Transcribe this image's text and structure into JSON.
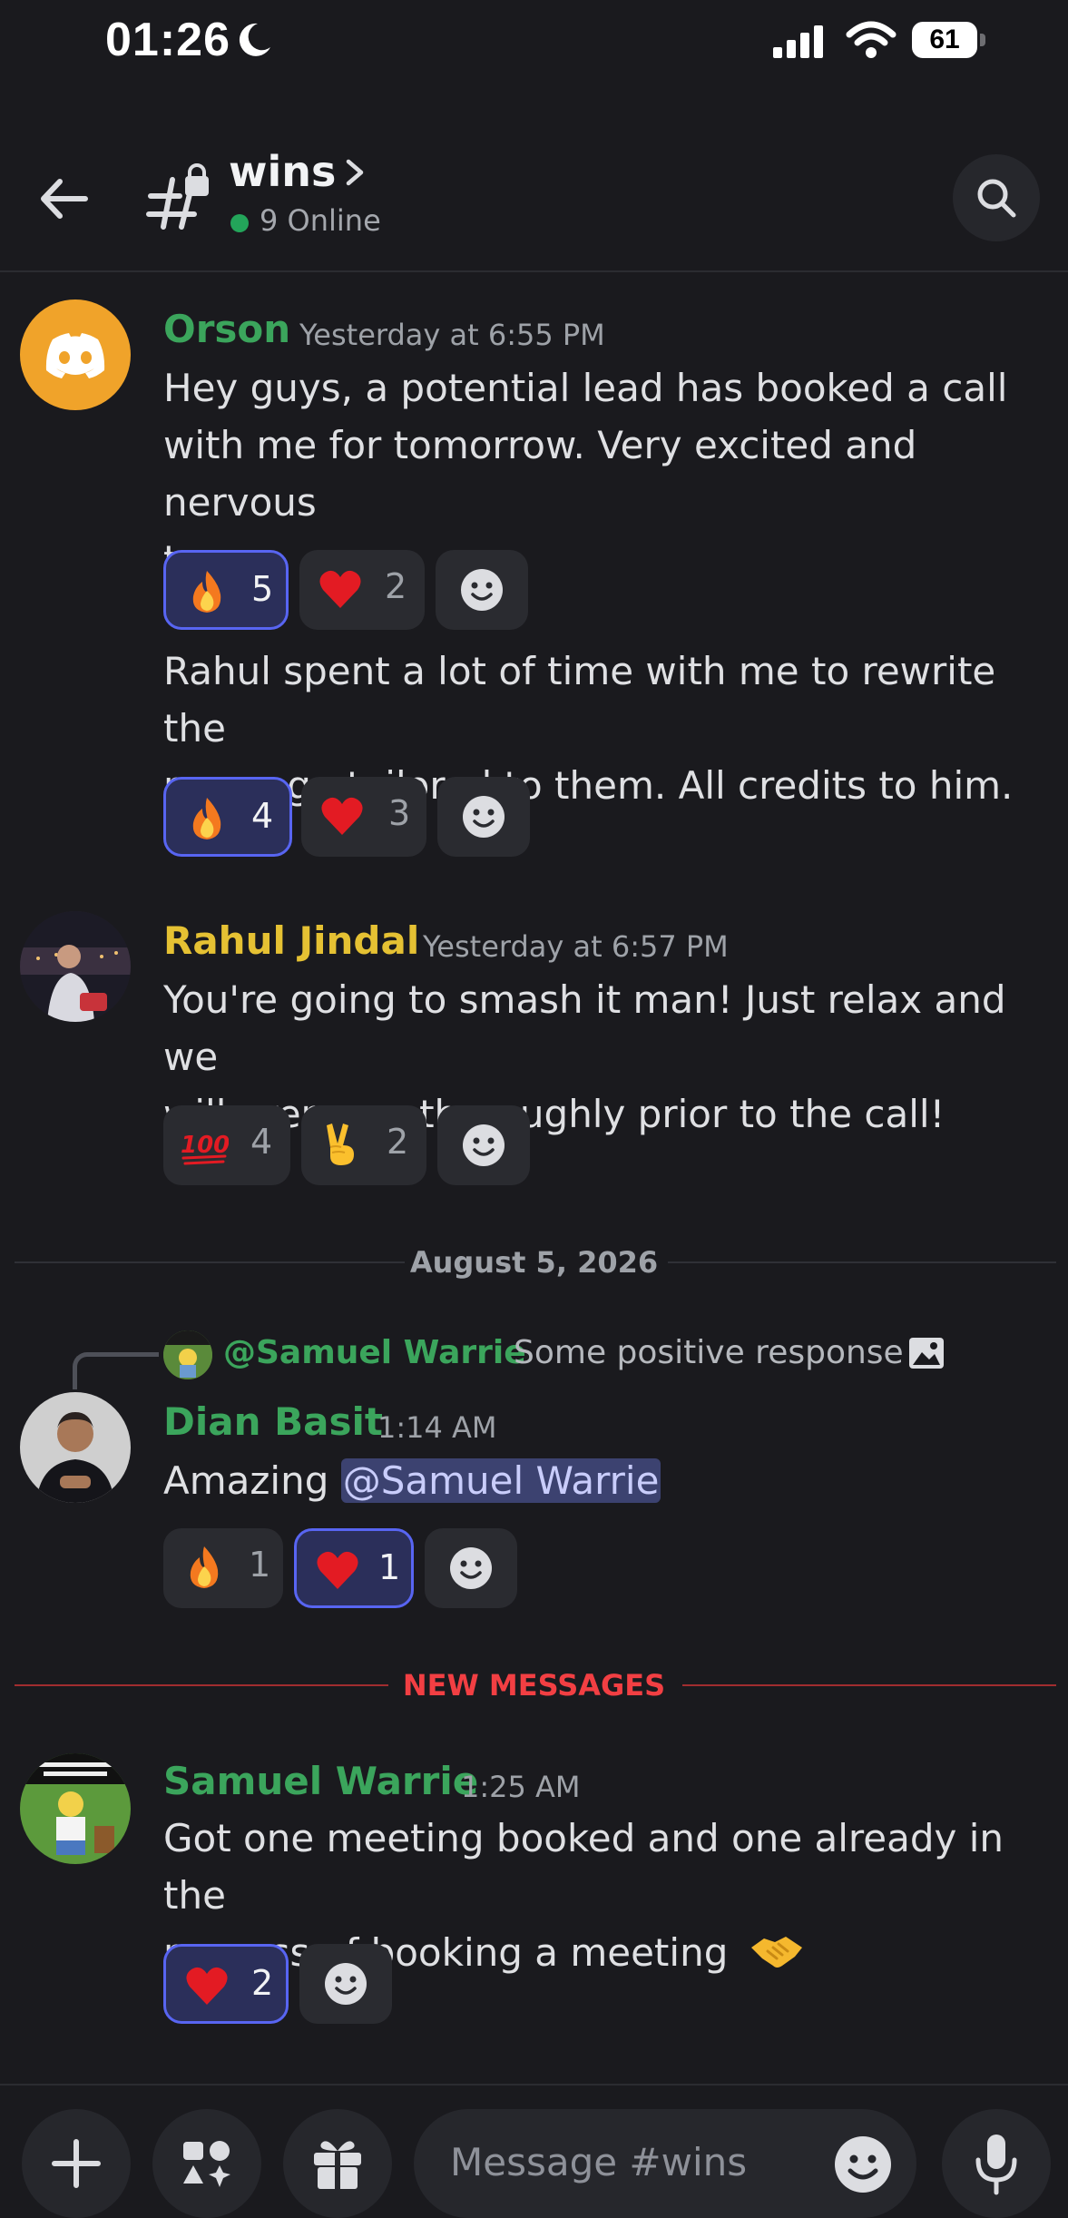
{
  "status_bar": {
    "time": "01:26",
    "battery": "61"
  },
  "header": {
    "channel_name": "wins",
    "online": "9 Online"
  },
  "messages": [
    {
      "author": "Orson",
      "author_color": "#3ba55c",
      "timestamp": "Yesterday at 6:55 PM",
      "text_lines": [
        "Hey guys, a potential lead has booked a call",
        "with me for tomorrow. Very excited and nervous",
        "too."
      ],
      "reactions": [
        {
          "emoji": "fire",
          "count": "5",
          "selected": true
        },
        {
          "emoji": "red-heart",
          "count": "2",
          "selected": false
        }
      ],
      "followup_lines": [
        "Rahul spent a lot of time with me to rewrite the",
        "message tailored to them. All credits to him."
      ],
      "followup_reactions": [
        {
          "emoji": "fire",
          "count": "4",
          "selected": true
        },
        {
          "emoji": "red-heart",
          "count": "3",
          "selected": false
        }
      ]
    },
    {
      "author": "Rahul Jindal",
      "author_color": "#e5c133",
      "timestamp": "Yesterday at 6:57 PM",
      "text_lines": [
        "You're going to smash it man! Just relax and we",
        "will prep you thoroughly prior to the call!"
      ],
      "reactions": [
        {
          "emoji": "hundred",
          "count": "4",
          "selected": false
        },
        {
          "emoji": "victory-hand",
          "count": "2",
          "selected": false
        }
      ]
    },
    {
      "reply_to": "@Samuel Warrie",
      "reply_preview": "Some positive response",
      "author": "Dian Basit",
      "author_color": "#3ba55c",
      "timestamp": "1:14 AM",
      "text": "Amazing",
      "mention": "@Samuel Warrie",
      "reactions": [
        {
          "emoji": "fire",
          "count": "1",
          "selected": false
        },
        {
          "emoji": "red-heart",
          "count": "1",
          "selected": true
        }
      ]
    },
    {
      "author": "Samuel Warrie",
      "author_color": "#3ba55c",
      "timestamp": "1:25 AM",
      "text_lines": [
        "Got one meeting booked and one already in the",
        "process of booking a meeting"
      ],
      "reactions": [
        {
          "emoji": "red-heart",
          "count": "2",
          "selected": true
        }
      ]
    }
  ],
  "date_divider": "August 5, 2026",
  "new_messages_label": "NEW MESSAGES",
  "composer": {
    "placeholder": "Message #wins"
  }
}
